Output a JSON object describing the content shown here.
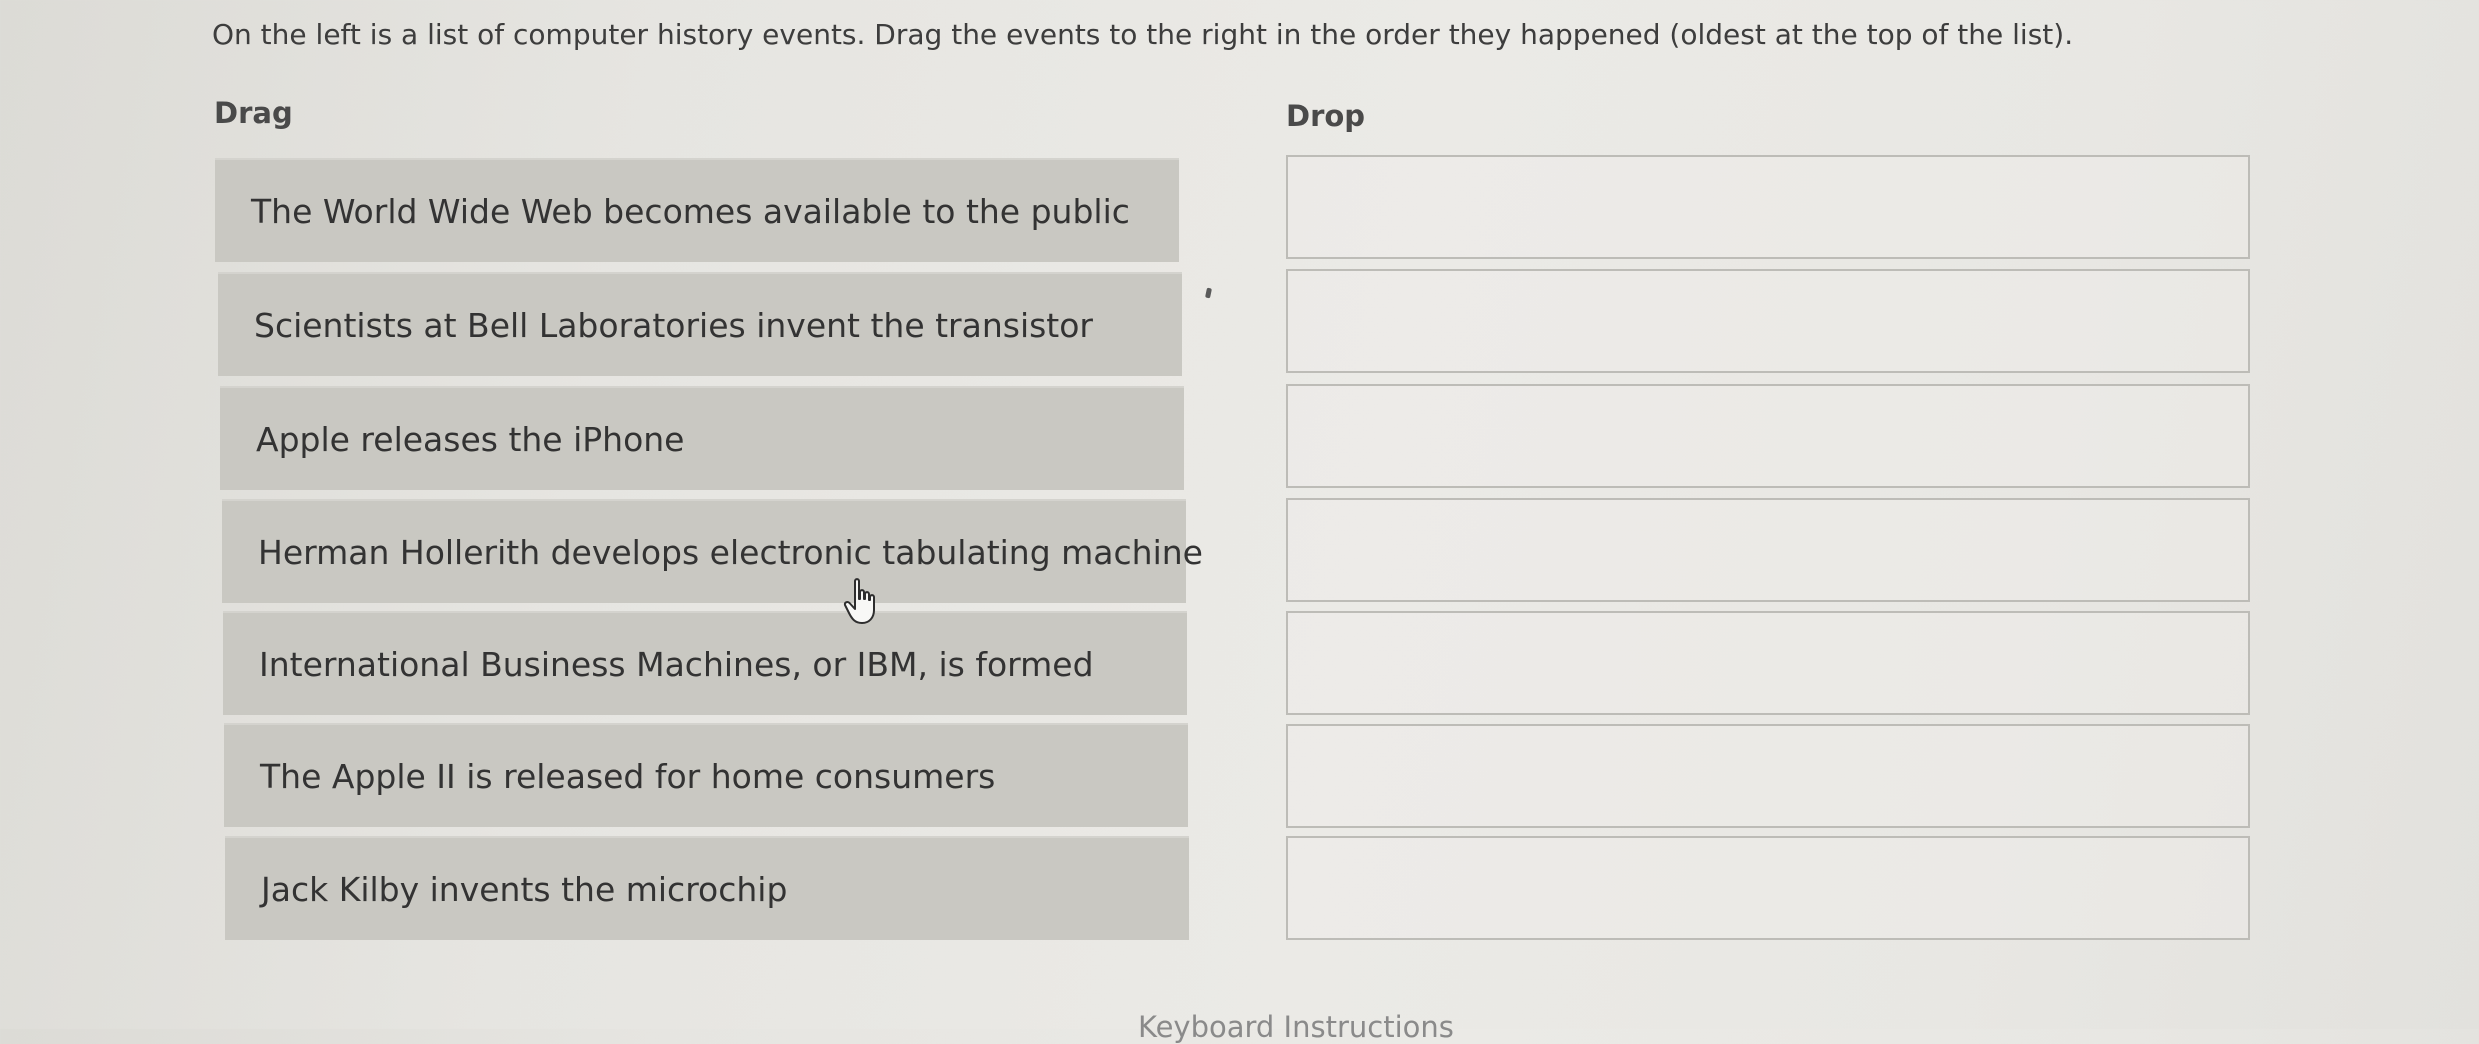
{
  "instructions": "On the left is a list of computer history events. Drag the events to the right in the order they happened (oldest at the top of the list).",
  "drag_heading": "Drag",
  "drop_heading": "Drop",
  "drag_items": [
    {
      "label": "The World Wide Web becomes available to the public"
    },
    {
      "label": "Scientists at Bell Laboratories invent the transistor"
    },
    {
      "label": "Apple releases the iPhone"
    },
    {
      "label": "Herman Hollerith develops electronic tabulating machine"
    },
    {
      "label": "International Business Machines, or IBM, is formed"
    },
    {
      "label": "The Apple II is released for home consumers"
    },
    {
      "label": "Jack Kilby invents the microchip"
    }
  ],
  "drop_slots_count": 7,
  "footer": {
    "keyboard_instructions": "Keyboard Instructions"
  },
  "colors": {
    "drag_item_bg": "#c9c8c2",
    "drop_box_border": "#bdbcb7",
    "text": "#333333"
  },
  "icons": {
    "cursor": "hand-pointer-icon"
  }
}
